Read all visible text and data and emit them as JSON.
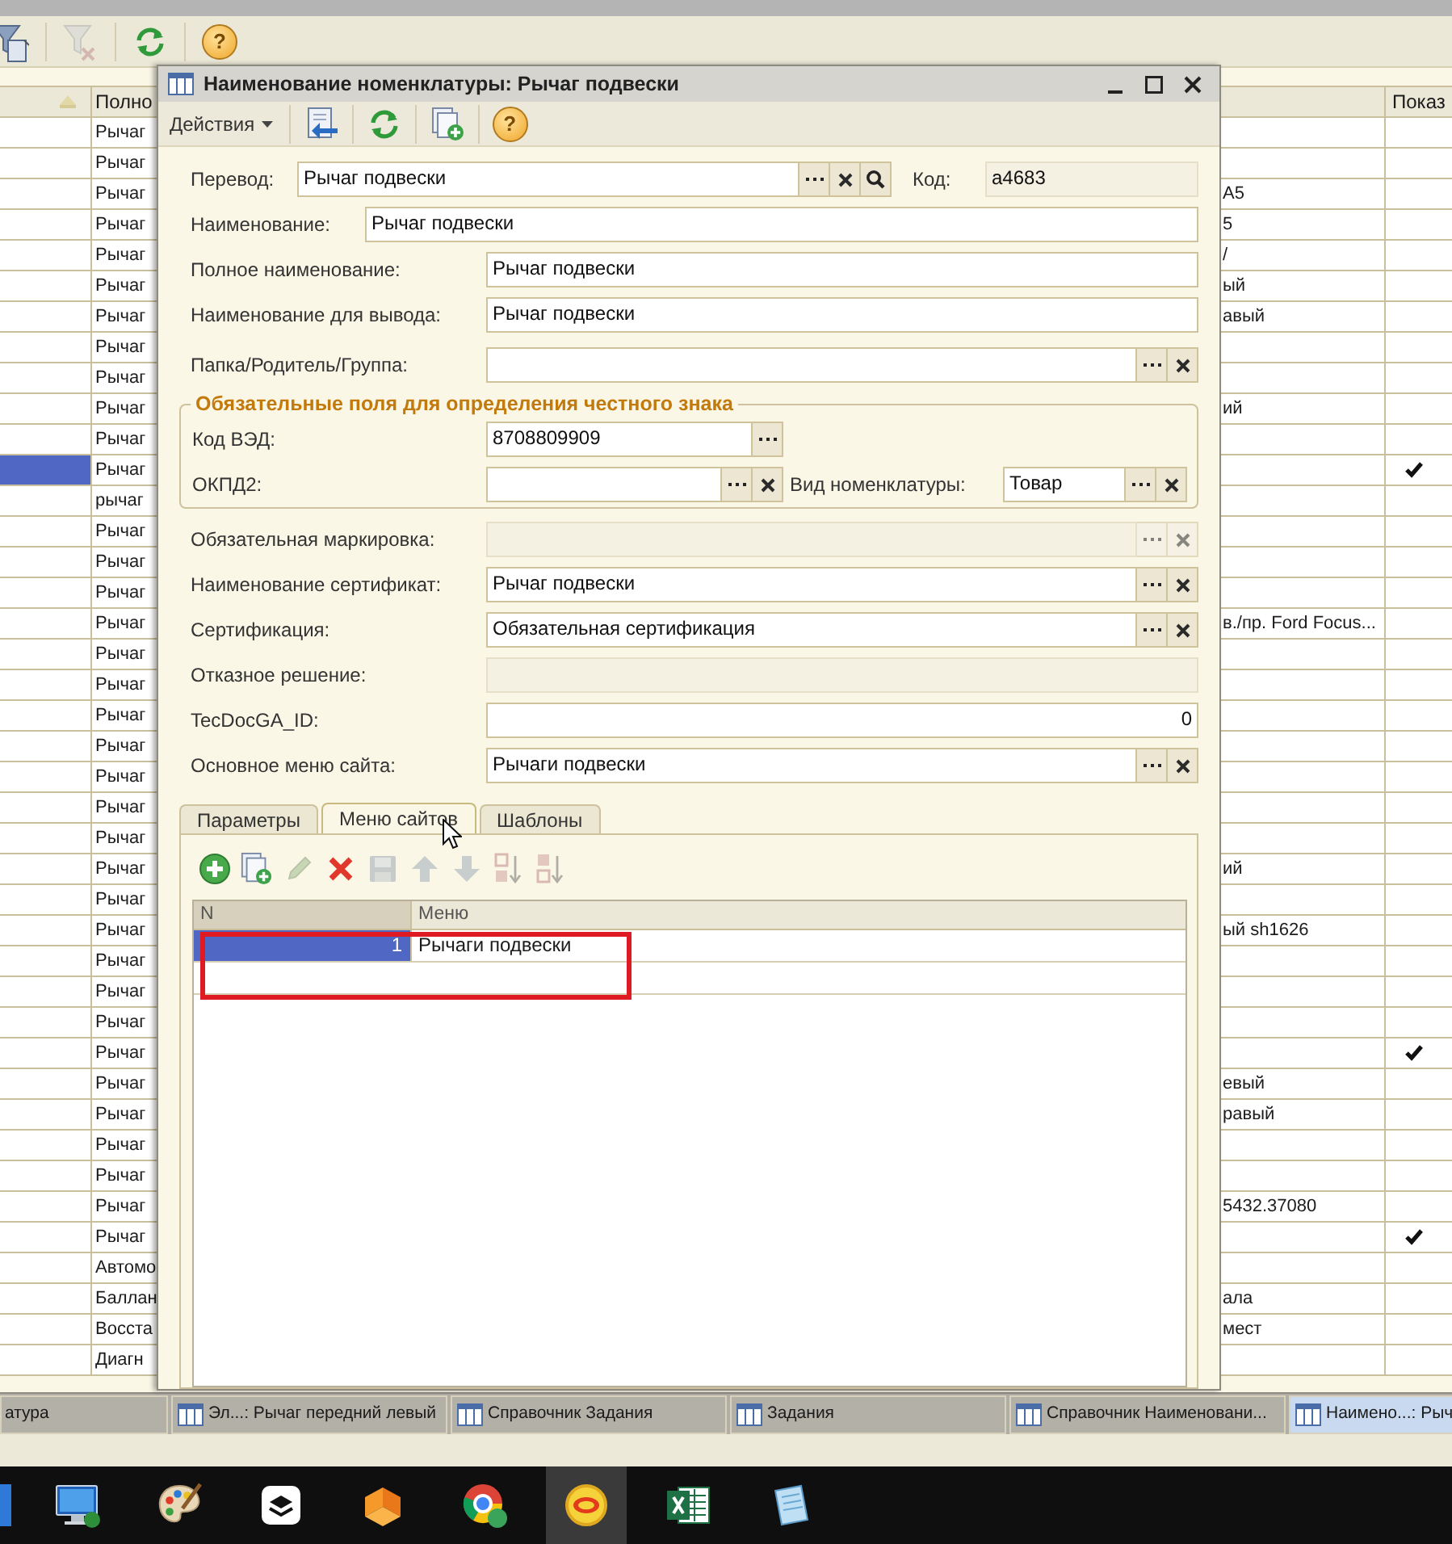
{
  "app_toolbar": {
    "tools": [
      {
        "kind": "filter",
        "disabled": false
      },
      {
        "kind": "filter_clear",
        "disabled": true
      },
      {
        "kind": "refresh",
        "disabled": false
      }
    ],
    "help": "?"
  },
  "list": {
    "header": {
      "column_2": "Полно",
      "column_4": "Показ"
    },
    "rows": [
      {
        "column_2": "Рычаг",
        "selected": false,
        "checked": false
      },
      {
        "column_2": "Рычаг",
        "selected": false,
        "checked": false
      },
      {
        "column_2": "Рычаг",
        "column_3": "А5",
        "selected": false,
        "checked": false
      },
      {
        "column_2": "Рычаг",
        "column_3": "5",
        "selected": false,
        "checked": false
      },
      {
        "column_2": "Рычаг",
        "column_3": "/",
        "selected": false,
        "checked": false
      },
      {
        "column_2": "Рычаг",
        "column_3": "ый",
        "selected": false,
        "checked": false
      },
      {
        "column_2": "Рычаг",
        "column_3": "авый",
        "selected": false,
        "checked": false
      },
      {
        "column_2": "Рычаг",
        "selected": false,
        "checked": false
      },
      {
        "column_2": "Рычаг",
        "selected": false,
        "checked": false
      },
      {
        "column_2": "Рычаг",
        "column_3": "ий",
        "selected": false,
        "checked": false
      },
      {
        "column_2": "Рычаг",
        "selected": false,
        "checked": false
      },
      {
        "column_2": "Рычаг",
        "selected": true,
        "checked": true
      },
      {
        "column_2": "рычаг",
        "selected": false,
        "checked": false
      },
      {
        "column_2": "Рычаг",
        "selected": false,
        "checked": false
      },
      {
        "column_2": "Рычаг",
        "selected": false,
        "checked": false
      },
      {
        "column_2": "Рычаг",
        "selected": false,
        "checked": false
      },
      {
        "column_2": "Рычаг",
        "column_3": "в./пр. Ford Focus...",
        "selected": false,
        "checked": false
      },
      {
        "column_2": "Рычаг",
        "selected": false,
        "checked": false
      },
      {
        "column_2": "Рычаг",
        "selected": false,
        "checked": false
      },
      {
        "column_2": "Рычаг",
        "selected": false,
        "checked": false
      },
      {
        "column_2": "Рычаг",
        "selected": false,
        "checked": false
      },
      {
        "column_2": "Рычаг",
        "selected": false,
        "checked": false
      },
      {
        "column_2": "Рычаг",
        "selected": false,
        "checked": false
      },
      {
        "column_2": "Рычаг",
        "selected": false,
        "checked": false
      },
      {
        "column_2": "Рычаг",
        "column_3": "ий",
        "selected": false,
        "checked": false
      },
      {
        "column_2": "Рычаг",
        "selected": false,
        "checked": false
      },
      {
        "column_2": "Рычаг",
        "column_3": "ый sh1626",
        "selected": false,
        "checked": false
      },
      {
        "column_2": "Рычаг",
        "selected": false,
        "checked": false
      },
      {
        "column_2": "Рычаг",
        "selected": false,
        "checked": false
      },
      {
        "column_2": "Рычаг",
        "selected": false,
        "checked": false
      },
      {
        "column_2": "Рычаг",
        "selected": false,
        "checked": true
      },
      {
        "column_2": "Рычаг",
        "column_3": "евый",
        "selected": false,
        "checked": false
      },
      {
        "column_2": "Рычаг",
        "column_3": "равый",
        "selected": false,
        "checked": false
      },
      {
        "column_2": "Рычаг",
        "selected": false,
        "checked": false
      },
      {
        "column_2": "Рычаг",
        "selected": false,
        "checked": false
      },
      {
        "column_2": "Рычаг",
        "column_3": "5432.37080",
        "selected": false,
        "checked": false
      },
      {
        "column_2": "Рычаг",
        "selected": false,
        "checked": true
      },
      {
        "column_2": "Автомо",
        "selected": false,
        "checked": false
      },
      {
        "column_2": "Баллан",
        "column_3": "ала",
        "selected": false,
        "checked": false
      },
      {
        "column_2": "Восста",
        "column_3": "мест",
        "selected": false,
        "checked": false
      },
      {
        "column_2": "Диагн",
        "selected": false,
        "checked": false
      }
    ]
  },
  "dialog": {
    "title": "Наименование номенклатуры: Рычаг подвески",
    "toolbar": {
      "actions": "Действия",
      "tools": [
        {
          "kind": "save_close"
        },
        {
          "kind": "refresh"
        },
        {
          "kind": "copy"
        }
      ],
      "help": "?"
    },
    "fields": [
      {
        "kind": "field",
        "label": "Перевод:",
        "value": "Рычаг подвески",
        "buttons": [
          {
            "kind": "select"
          },
          {
            "kind": "clear"
          },
          {
            "kind": "search"
          }
        ],
        "side": {
          "label": "Код:",
          "value": "а4683",
          "disabled": true
        }
      },
      {
        "kind": "field",
        "label": "Наименование:",
        "value": "Рычаг подвески"
      },
      {
        "kind": "field",
        "label": "Полное наименование:",
        "value": "Рычаг подвески"
      },
      {
        "kind": "field",
        "label": "Наименование для вывода:",
        "value": "Рычаг подвески"
      },
      {
        "kind": "field",
        "label": "Папка/Родитель/Группа:",
        "buttons": [
          {
            "kind": "select"
          },
          {
            "kind": "clear"
          }
        ]
      },
      {
        "kind": "group",
        "title": "Обязательные поля для определения честного знака",
        "fields": [
          {
            "kind": "field",
            "label": "Код ВЭД:",
            "value": "8708809909",
            "buttons": [
              {
                "kind": "select"
              }
            ]
          },
          {
            "kind": "field",
            "label": "ОКПД2:",
            "buttons": [
              {
                "kind": "select"
              },
              {
                "kind": "clear"
              }
            ],
            "side": {
              "label": "Вид номенклатуры:",
              "value": "Товар",
              "buttons": [
                {
                  "kind": "select"
                },
                {
                  "kind": "clear"
                }
              ]
            }
          }
        ]
      },
      {
        "kind": "field",
        "label": "Обязательная маркировка:",
        "disabled": true,
        "buttons": [
          {
            "kind": "select"
          },
          {
            "kind": "clear"
          }
        ]
      },
      {
        "kind": "field",
        "label": "Наименование сертификат:",
        "value": "Рычаг подвески",
        "buttons": [
          {
            "kind": "select"
          },
          {
            "kind": "clear"
          }
        ]
      },
      {
        "kind": "field",
        "label": "Сертификация:",
        "value": "Обязательная сертификация",
        "buttons": [
          {
            "kind": "select"
          },
          {
            "kind": "clear"
          }
        ]
      },
      {
        "kind": "field",
        "label": "Отказное решение:",
        "disabled": true
      },
      {
        "kind": "number",
        "label": "TecDocGA_ID:",
        "value": "0"
      },
      {
        "kind": "field",
        "label": "Основное меню сайта:",
        "value": "Рычаги подвески",
        "buttons": [
          {
            "kind": "select"
          },
          {
            "kind": "clear"
          }
        ]
      }
    ],
    "tabs": [
      {
        "label": "Параметры",
        "selected": false
      },
      {
        "label": "Меню сайтов",
        "selected": true
      },
      {
        "label": "Шаблоны",
        "selected": false
      }
    ],
    "panel_toolbar": [
      {
        "kind": "add",
        "disabled": false
      },
      {
        "kind": "copy",
        "disabled": false
      },
      {
        "kind": "edit",
        "disabled": true
      },
      {
        "kind": "delete",
        "disabled": false
      },
      {
        "kind": "save",
        "disabled": true
      },
      {
        "kind": "up",
        "disabled": true
      },
      {
        "kind": "down",
        "disabled": true
      },
      {
        "kind": "sort_asc",
        "disabled": true
      },
      {
        "kind": "sort_desc",
        "disabled": true
      }
    ],
    "menu_table": {
      "columns": [
        "N",
        "Меню"
      ],
      "rows": [
        {
          "n": "1",
          "menu": "Рычаги подвески",
          "selected": true
        }
      ]
    }
  },
  "window_tabs": [
    {
      "label": "атура",
      "icon": false,
      "selected": false
    },
    {
      "label": "Эл...: Рычаг передний левый",
      "icon": true,
      "selected": false
    },
    {
      "label": "Справочник Задания",
      "icon": true,
      "selected": false
    },
    {
      "label": "Задания",
      "icon": true,
      "selected": false
    },
    {
      "label": "Справочник Наименовани...",
      "icon": true,
      "selected": false
    },
    {
      "label": "Наимено...: Рыч",
      "icon": true,
      "selected": true
    }
  ],
  "taskbar": [
    {
      "kind": "window",
      "active": false
    },
    {
      "kind": "monitor",
      "active": false
    },
    {
      "kind": "palette",
      "active": false
    },
    {
      "kind": "layers",
      "active": false
    },
    {
      "kind": "folded",
      "active": false
    },
    {
      "kind": "ring",
      "active": false
    },
    {
      "kind": "coin",
      "active": true
    },
    {
      "kind": "spreadsheet",
      "active": false
    },
    {
      "kind": "notepad",
      "active": false
    }
  ]
}
